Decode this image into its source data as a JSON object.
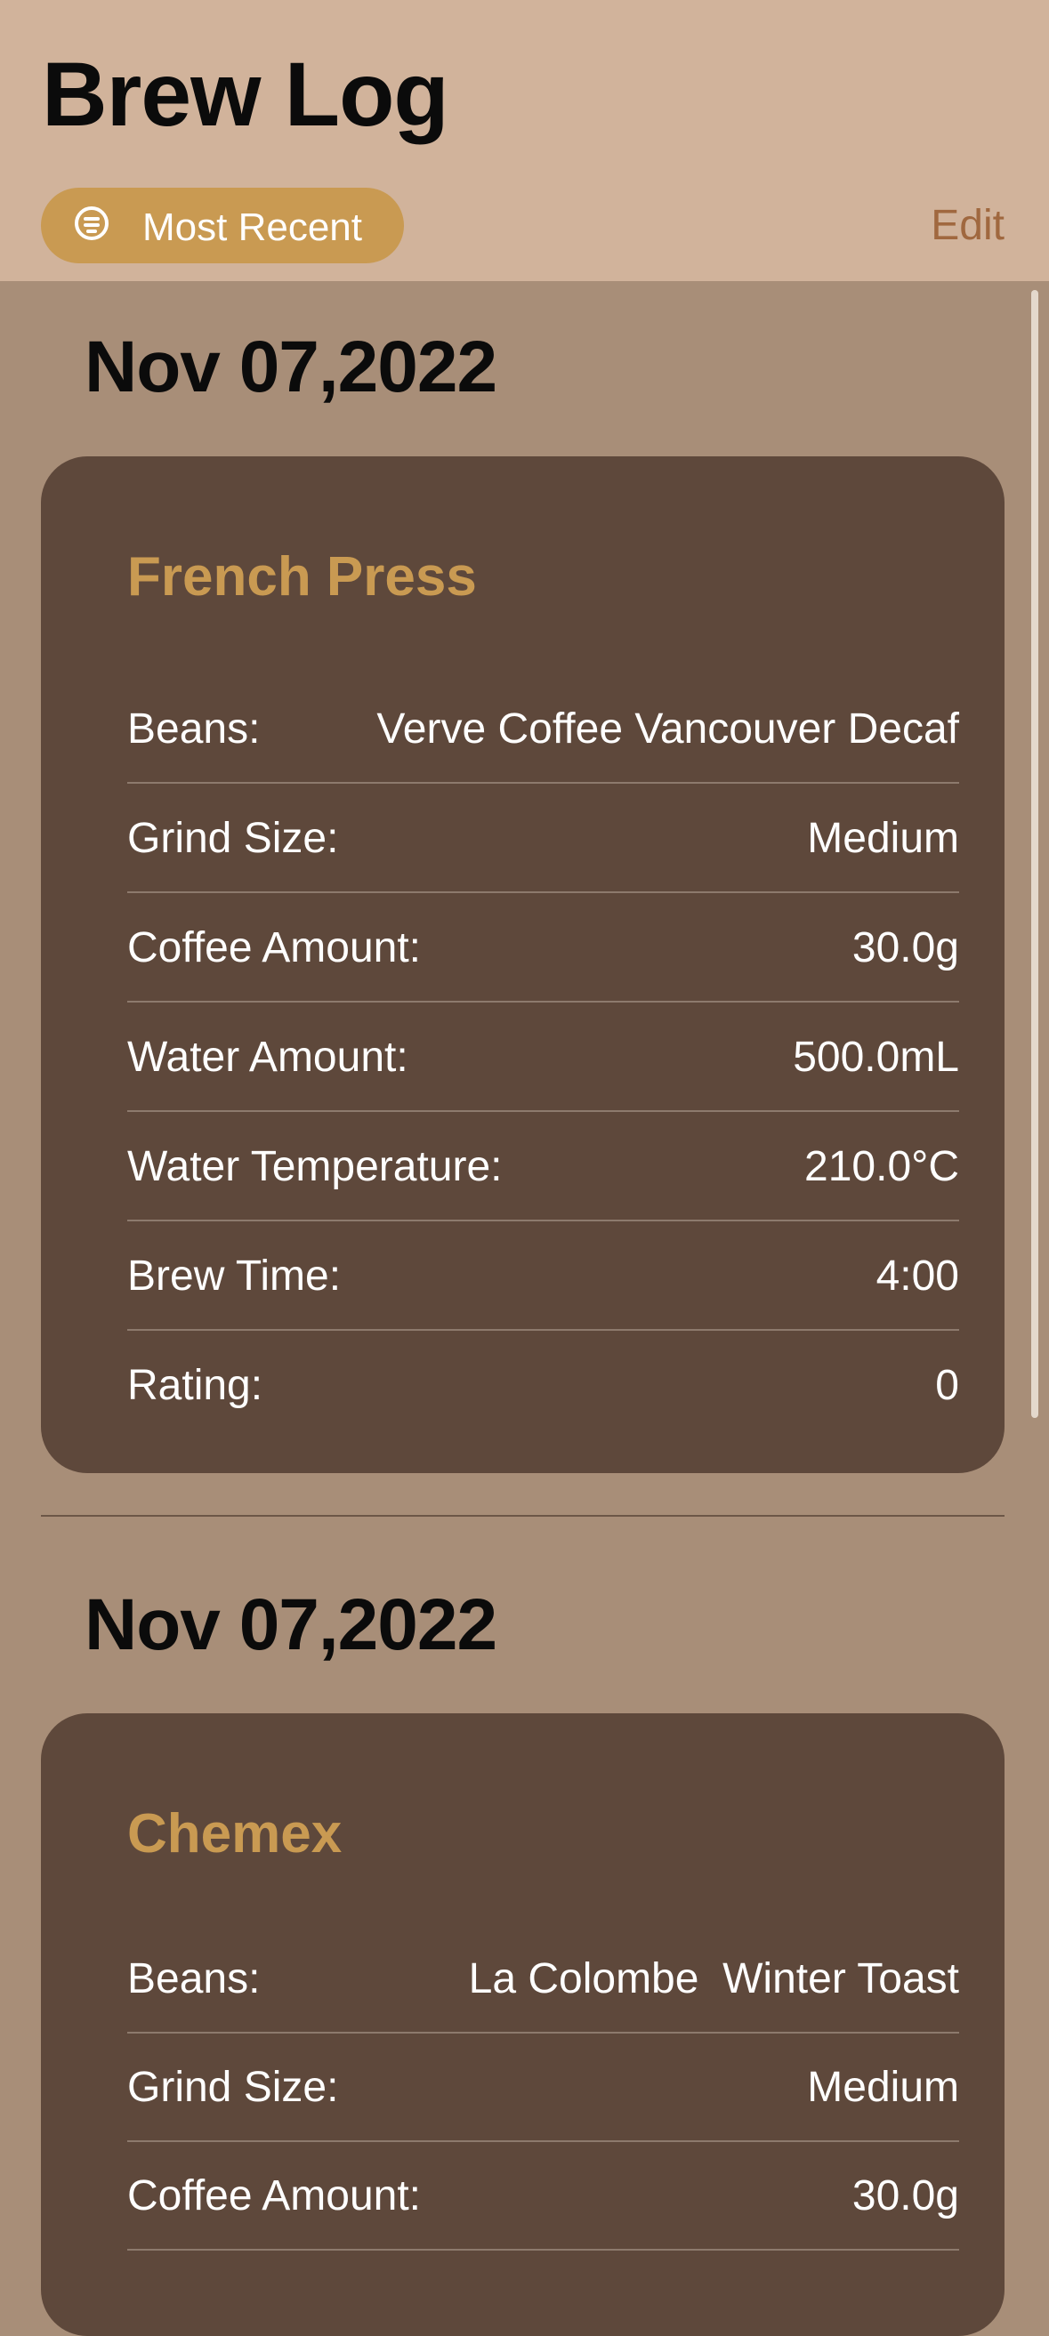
{
  "app": {
    "title": "Brew Log"
  },
  "toolbar": {
    "sort_label": "Most Recent",
    "edit_label": "Edit"
  },
  "entries": [
    {
      "date": "Nov 07,2022",
      "method": "French Press",
      "rows": [
        {
          "label": "Beans:",
          "value": "Verve Coffee Vancouver Decaf"
        },
        {
          "label": "Grind Size:",
          "value": "Medium"
        },
        {
          "label": "Coffee Amount:",
          "value": "30.0g"
        },
        {
          "label": "Water Amount:",
          "value": "500.0mL"
        },
        {
          "label": "Water Temperature:",
          "value": "210.0°C"
        },
        {
          "label": "Brew Time:",
          "value": "4:00"
        },
        {
          "label": "Rating:",
          "value": "0"
        }
      ]
    },
    {
      "date": "Nov 07,2022",
      "method": "Chemex",
      "rows": [
        {
          "label": "Beans:",
          "value": "La Colombe  Winter Toast"
        },
        {
          "label": "Grind Size:",
          "value": "Medium"
        },
        {
          "label": "Coffee Amount:",
          "value": "30.0g"
        }
      ]
    }
  ],
  "colors": {
    "header_bg": "#d1b39b",
    "page_bg": "#a88e78",
    "card_bg": "#5e483b",
    "accent": "#c99a52",
    "edit": "#a0683f"
  }
}
